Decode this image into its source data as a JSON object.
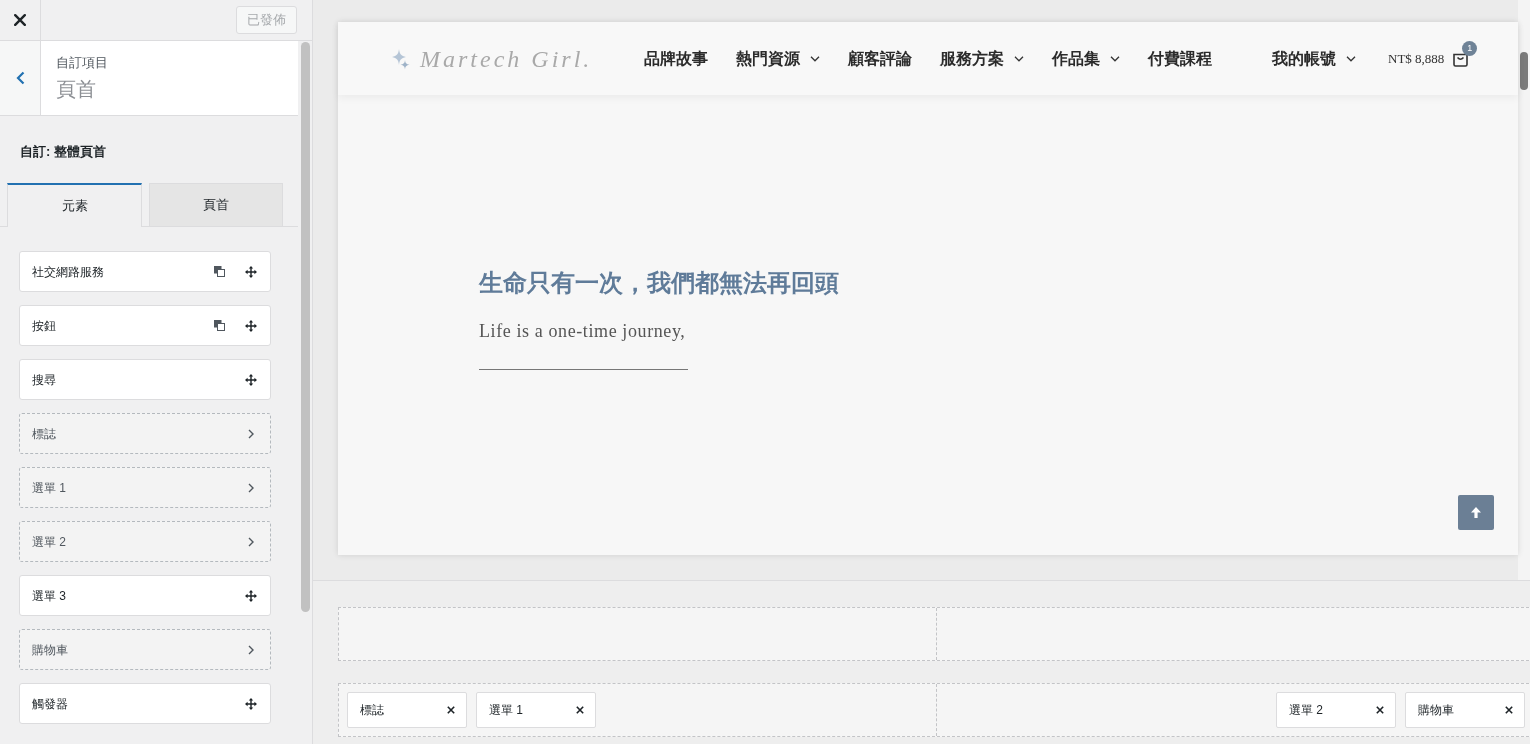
{
  "top_bar": {
    "publish_button": {
      "label": "已發佈",
      "disabled": true
    }
  },
  "section": {
    "breadcrumb": "自訂項目",
    "title": "頁首"
  },
  "heading": "自訂: 整體頁首",
  "tabs": [
    {
      "label": "元素",
      "selected": true
    },
    {
      "label": "頁首",
      "selected": false
    }
  ],
  "elements": [
    {
      "label": "社交網路服務",
      "kind": "available",
      "duplicable": true
    },
    {
      "label": "按鈕",
      "kind": "available",
      "duplicable": true
    },
    {
      "label": "搜尋",
      "kind": "available",
      "duplicable": false
    },
    {
      "label": "標誌",
      "kind": "placed",
      "duplicable": false
    },
    {
      "label": "選單 1",
      "kind": "placed",
      "duplicable": false
    },
    {
      "label": "選單 2",
      "kind": "placed",
      "duplicable": false
    },
    {
      "label": "選單 3",
      "kind": "available",
      "duplicable": false
    },
    {
      "label": "購物車",
      "kind": "placed",
      "duplicable": false
    },
    {
      "label": "觸發器",
      "kind": "available",
      "duplicable": false
    }
  ],
  "site_header": {
    "logo_text": "Martech Girl.",
    "menu": [
      {
        "label": "品牌故事",
        "has_dropdown": false
      },
      {
        "label": "熱門資源",
        "has_dropdown": true
      },
      {
        "label": "顧客評論",
        "has_dropdown": false
      },
      {
        "label": "服務方案",
        "has_dropdown": true
      },
      {
        "label": "作品集",
        "has_dropdown": true
      },
      {
        "label": "付費課程",
        "has_dropdown": false
      }
    ],
    "account": {
      "label": "我的帳號",
      "has_dropdown": true
    },
    "cart": {
      "total": "NT$ 8,888",
      "count": "1"
    }
  },
  "hero": {
    "title": "生命只有一次，我們都無法再回頭",
    "subtitle": "Life is a one-time journey,"
  },
  "builder": {
    "rows": [
      {},
      {
        "left": [
          {
            "label": "標誌"
          },
          {
            "label": "選單 1"
          }
        ],
        "right": [
          {
            "label": "選單 2"
          },
          {
            "label": "購物車"
          }
        ]
      }
    ]
  }
}
